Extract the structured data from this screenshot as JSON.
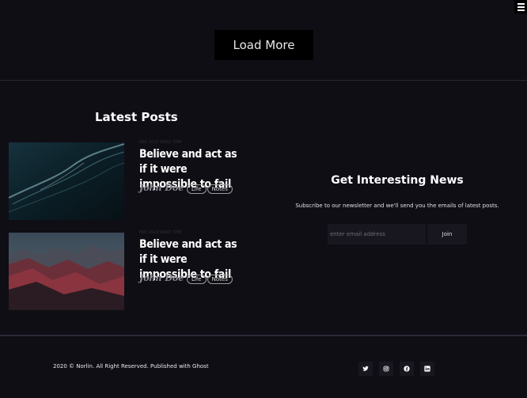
{
  "header": {
    "menu_icon": "hamburger-icon"
  },
  "load_more": {
    "label": "Load More"
  },
  "latest_posts": {
    "title": "Latest Posts",
    "posts": [
      {
        "meta": "MAY 2023 READ TIME",
        "title": "Believe and act as if it were impossible to fail",
        "author": "John Doe",
        "tags": [
          "Life",
          "Notes"
        ],
        "image": "ocean-waves"
      },
      {
        "meta": "MAY 2023 READ TIME",
        "title": "Believe and act as if it were impossible to fail",
        "author": "John Doe",
        "tags": [
          "Life",
          "Notes"
        ],
        "image": "red-mountains"
      }
    ]
  },
  "newsletter": {
    "title": "Get Interesting News",
    "description": "Subscribe to our newsletter and we'll send you the emails of latest posts.",
    "email_placeholder": "enter email address",
    "join_label": "Join"
  },
  "footer": {
    "copyright": "2020 © Norlin. All Right Reserved. Published with Ghost",
    "socials": [
      "twitter-icon",
      "instagram-icon",
      "facebook-icon",
      "linkedin-icon"
    ]
  }
}
